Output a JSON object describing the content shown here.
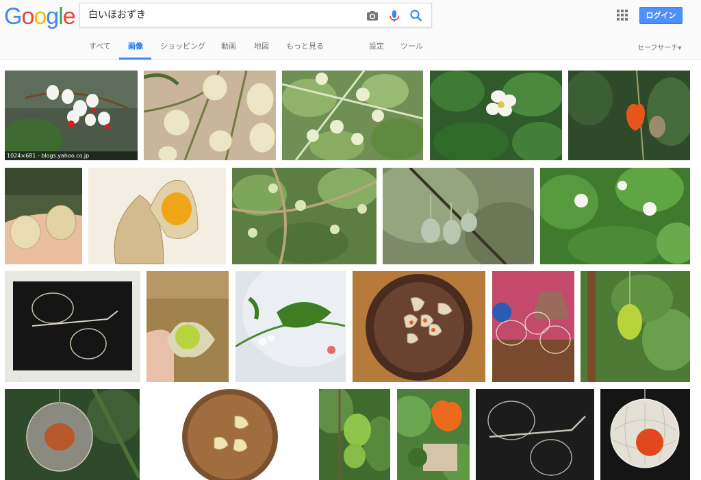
{
  "logo": {
    "text": "Google"
  },
  "search": {
    "query": "白いほおずき"
  },
  "header": {
    "login_label": "ログイン"
  },
  "tabs": [
    {
      "label": "すべて"
    },
    {
      "label": "画像"
    },
    {
      "label": "ショッピング"
    },
    {
      "label": "動画"
    },
    {
      "label": "地図"
    },
    {
      "label": "もっと見る"
    },
    {
      "label": "設定"
    },
    {
      "label": "ツール"
    }
  ],
  "safe_search": {
    "label": "セーフサーチ▾"
  },
  "results": {
    "first_caption": "1024×681 - blogs.yahoo.co.jp"
  },
  "colors": {
    "accent": "#4285f4",
    "login_bg": "#4d90fe",
    "tab_active": "#1a73e8"
  },
  "icons": [
    "camera-icon",
    "microphone-icon",
    "search-icon",
    "apps-grid-icon"
  ]
}
